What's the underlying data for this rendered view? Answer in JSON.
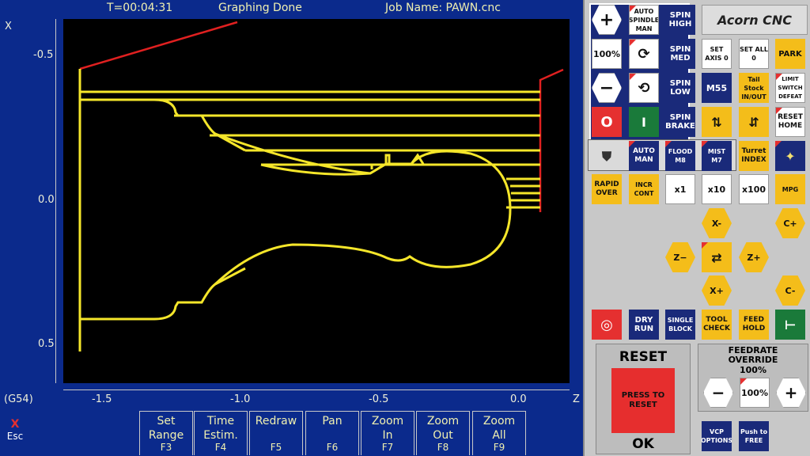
{
  "header": {
    "time": "T=00:04:31",
    "status": "Graphing Done",
    "job": "Job Name: PAWN.cnc"
  },
  "axes": {
    "x_axis_label": "X",
    "z_axis_label": "Z",
    "y_ticks": [
      "-0.5",
      "0.0",
      "0.5"
    ],
    "z_ticks": [
      "-1.5",
      "-1.0",
      "-0.5",
      "0.0"
    ]
  },
  "wcs": "(G54)",
  "esc": {
    "x": "X",
    "label": "Esc"
  },
  "fkeys": [
    {
      "l1": "Set",
      "l2": "Range",
      "fn": "F3"
    },
    {
      "l1": "Time",
      "l2": "Estim.",
      "fn": "F4"
    },
    {
      "l1": "Redraw",
      "l2": "",
      "fn": "F5"
    },
    {
      "l1": "Pan",
      "l2": "",
      "fn": "F6"
    },
    {
      "l1": "Zoom",
      "l2": "In",
      "fn": "F7"
    },
    {
      "l1": "Zoom",
      "l2": "Out",
      "fn": "F8"
    },
    {
      "l1": "Zoom",
      "l2": "All",
      "fn": "F9"
    }
  ],
  "colors": {
    "toolpath": "#f5e62a",
    "rapid": "#e02020",
    "background": "#000000",
    "screen": "#0b2a8c",
    "button_yellow": "#f4bd1a",
    "button_navy": "#1a2a7a"
  },
  "panel": {
    "logo": "Acorn CNC",
    "plus": "+",
    "p100": "100%",
    "minus": "−",
    "stop": "O",
    "start": "I",
    "auto_spindle": "AUTO SPINDLE MAN",
    "m3": "M3",
    "m4": "M4",
    "spin_high": "SPIN HIGH",
    "spin_med": "SPIN MED",
    "spin_low": "SPIN LOW",
    "spin_brake": "SPIN BRAKE",
    "set_axis": "SET AXIS 0",
    "set_all": "SET ALL 0",
    "park": "PARK",
    "m55": "M55",
    "tailstock": "Tail Stock IN/OUT",
    "limit": "LIMIT SWITCH DEFEAT",
    "reset_home": "RESET HOME",
    "auto_cool": "AUTO MAN",
    "flood": "FLOOD",
    "m8": "M8",
    "mist": "MIST",
    "m7": "M7",
    "turret": "Turret INDEX",
    "rapid_over": "RAPID OVER",
    "incr": "INCR CONT",
    "x1": "x1",
    "x10": "x10",
    "x100": "x100",
    "mpg": "MPG",
    "xm": "X-",
    "cp": "C+",
    "zm": "Z−",
    "zp": "Z+",
    "xp": "X+",
    "cm": "C-",
    "dry_run": "DRY RUN",
    "single_block": "SINGLE BLOCK",
    "tool_check": "TOOL CHECK",
    "feed_hold": "FEED HOLD",
    "reset_title": "RESET",
    "press_reset": "PRESS TO RESET",
    "ok": "OK",
    "feed_title": "FEEDRATE OVERRIDE",
    "feed_value": "100%",
    "feed_minus": "−",
    "feed_pct": "100%",
    "feed_plus": "+",
    "vcp": "VCP OPTIONS",
    "push_free": "Push to FREE"
  }
}
